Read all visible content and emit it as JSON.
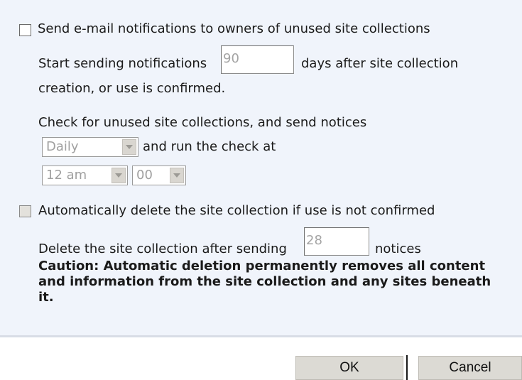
{
  "notifications": {
    "checkbox_label": "Send e-mail notifications to owners of unused site collections",
    "start_prefix": "Start sending notifications",
    "days_value": "90",
    "start_suffix": "days after site collection",
    "start_line2": "creation, or use is confirmed.",
    "check_text": "Check for unused site collections, and send notices",
    "frequency_selected": "Daily",
    "run_check_text": "and run the check at",
    "hour_selected": "12 am",
    "minute_selected": "00"
  },
  "deletion": {
    "checkbox_label": "Automatically delete the site collection if use is not confirmed",
    "delete_prefix": "Delete the site collection after sending",
    "notices_value": "28",
    "delete_suffix": "notices",
    "caution_text": "Caution: Automatic deletion permanently removes all content and information from the site collection and any sites beneath it."
  },
  "buttons": {
    "ok_label": "OK",
    "cancel_label": "Cancel"
  }
}
